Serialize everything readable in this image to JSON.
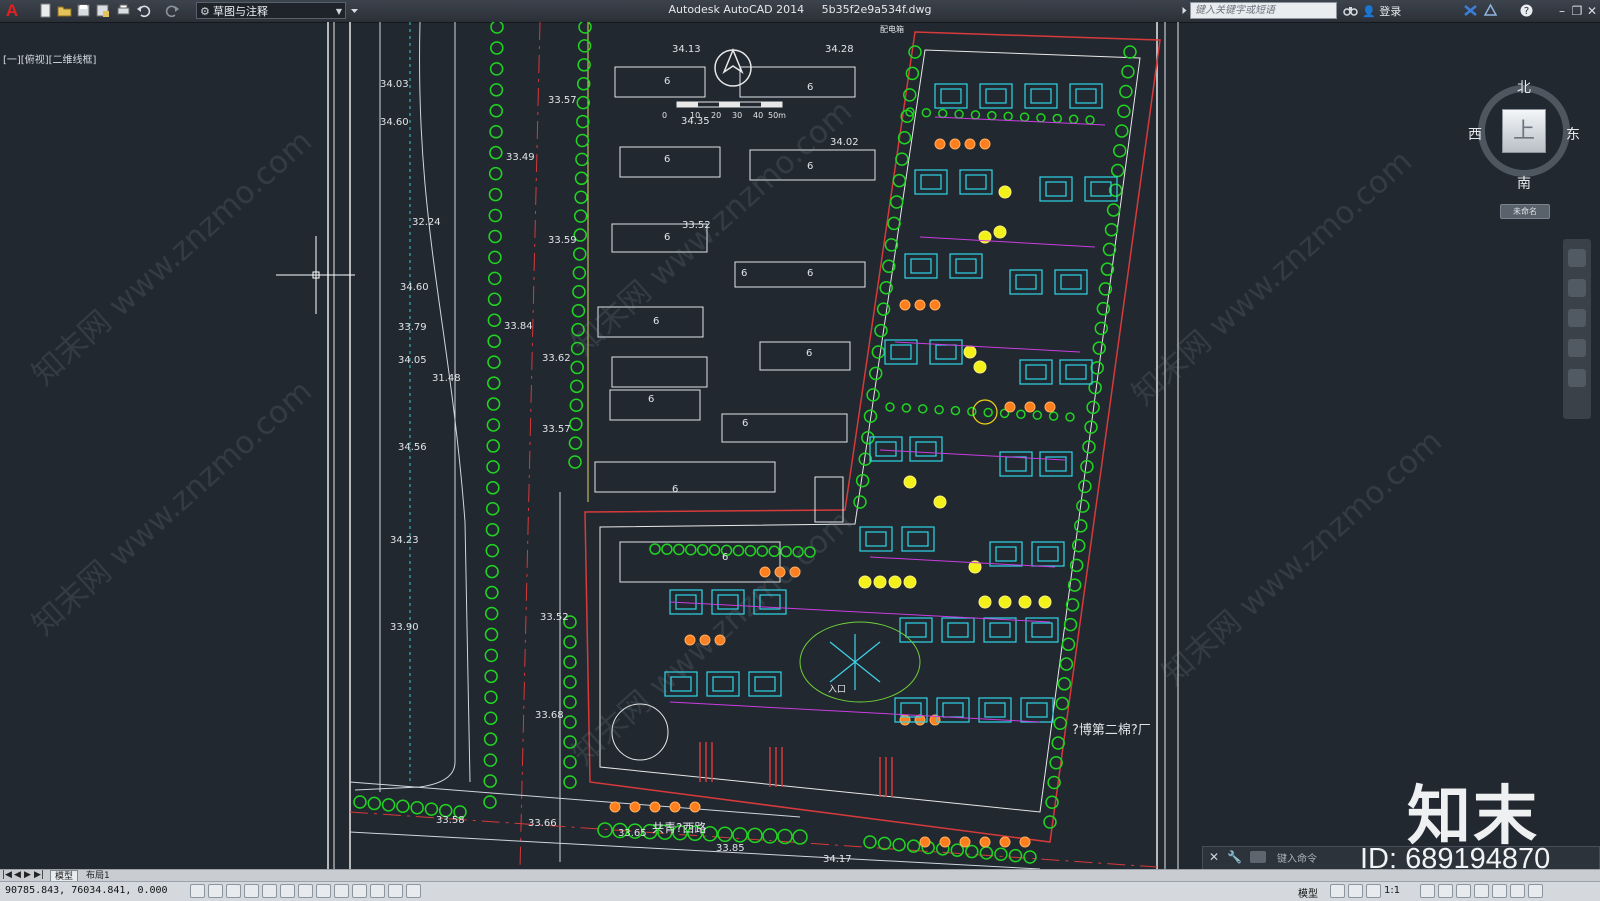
{
  "titlebar": {
    "app_name": "Autodesk AutoCAD 2014",
    "file_name": "5b35f2e9a534f.dwg",
    "workspace": "草图与注释",
    "search_placeholder": "键入关键字或短语",
    "login_label": "登录"
  },
  "viewport": {
    "label": "[一][俯视][二维线框]"
  },
  "viewcube": {
    "north": "北",
    "south": "南",
    "east": "东",
    "west": "西",
    "top_face": "上",
    "wcs_label": "未命名"
  },
  "drawing": {
    "elevations": [
      "34.13",
      "34.28",
      "33.57",
      "33.49",
      "34.35",
      "34.02",
      "32.24",
      "33.52",
      "33.59",
      "34.60",
      "33.84",
      "33.79",
      "33.62",
      "34.05",
      "31.48",
      "33.57",
      "34.23",
      "33.52",
      "33.90",
      "33.68",
      "34.03",
      "34.60",
      "34.56",
      "33.58",
      "33.66",
      "33.65",
      "33.85",
      "34.17"
    ],
    "road_name_south": "共青?西路",
    "factory_label": "?博第二棉?厂",
    "substation_label": "配电箱",
    "entrance_label": "入口",
    "scale_bar_labels": [
      "0",
      "10",
      "20",
      "30",
      "40",
      "50m"
    ],
    "building_storeys": "6"
  },
  "watermark": {
    "text": "知末网 www.znzmo.com",
    "logo": "知末",
    "id": "ID: 689194870"
  },
  "command": {
    "placeholder": "键入命令"
  },
  "layout_tabs": [
    "模型",
    "布局1"
  ],
  "status": {
    "coordinates": "90785.843, 76034.841, 0.000",
    "model_label": "模型",
    "scale_label": "1:1"
  }
}
